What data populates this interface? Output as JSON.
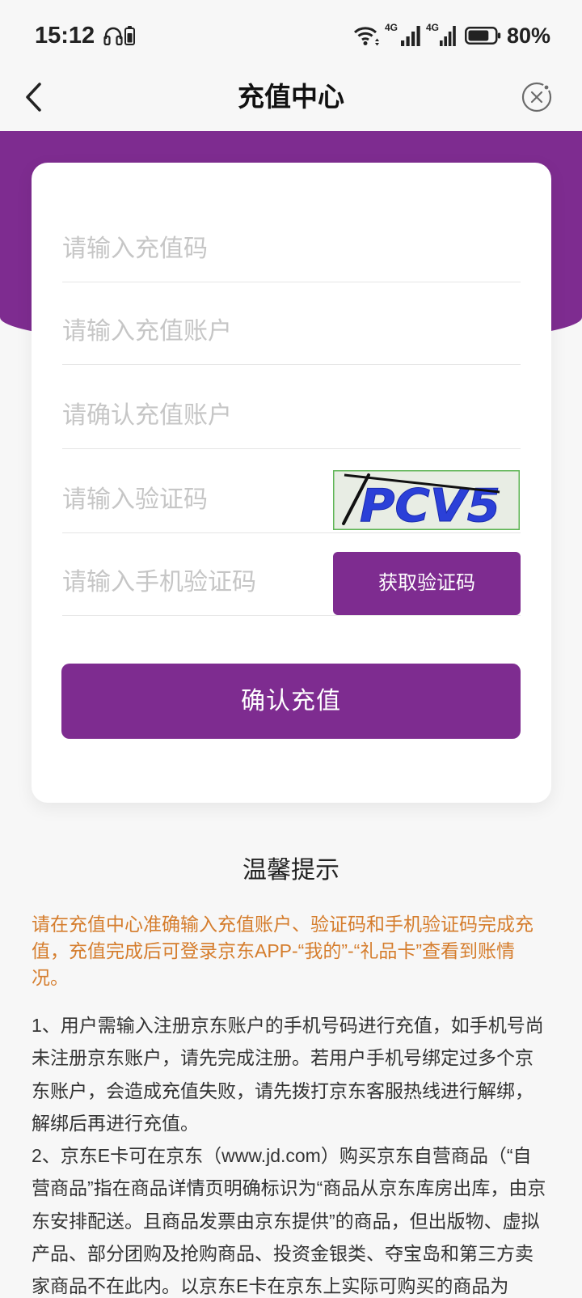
{
  "status_bar": {
    "time": "15:12",
    "network_1": "4G",
    "network_2": "4G",
    "battery_percent": "80%",
    "battery_level": 0.8,
    "icons": [
      "headphones-icon",
      "battery-small-icon",
      "wifi-icon",
      "signal-icon",
      "signal-icon",
      "battery-icon"
    ]
  },
  "header": {
    "title": "充值中心",
    "back_icon": "chevron-left-icon",
    "close_icon": "close-circle-icon"
  },
  "form": {
    "recharge_code": {
      "placeholder": "请输入充值码",
      "value": ""
    },
    "account": {
      "placeholder": "请输入充值账户",
      "value": ""
    },
    "confirm_account": {
      "placeholder": "请确认充值账户",
      "value": ""
    },
    "captcha": {
      "placeholder": "请输入验证码",
      "value": "",
      "image_text": "PCV5"
    },
    "sms_code": {
      "placeholder": "请输入手机验证码",
      "value": "",
      "button_label": "获取验证码"
    },
    "submit_label": "确认充值"
  },
  "tips": {
    "title": "温馨提示",
    "notice_lines": [
      "请在充值中心准确输入充值账户、验证码和手机验证码完成充",
      "值，充值完成后可登录京东APP-“我的”-“礼品卡”查看到账情",
      "况。"
    ],
    "rules": [
      {
        "lines": [
          "1、用户需输入注册京东账户的手机号码进行充值，如手机号尚",
          "未注册京东账户，请先完成注册。若用户手机号绑定过多个京",
          "东账户，会造成充值失败，请先拨打京东客服热线进行解绑，",
          "解绑后再进行充值。"
        ]
      },
      {
        "lines": [
          "2、京东E卡可在京东（www.jd.com）购买京东自营商品（“自",
          "营商品”指在商品详情页明确标识为“商品从京东库房出库，由京",
          "东安排配送。且商品发票由京东提供”的商品，但出版物、虚拟",
          "产品、部分团购及抢购商品、投资金银类、夺宝岛和第三方卖",
          "家商品不在此内。以京东E卡在京东上实际可购买的商品为"
        ]
      }
    ]
  },
  "colors": {
    "brand_purple": "#7e2c90",
    "notice_orange": "#d57d2d",
    "page_bg": "#f7f7f7",
    "text": "#333333",
    "placeholder": "#c6c6c6"
  }
}
